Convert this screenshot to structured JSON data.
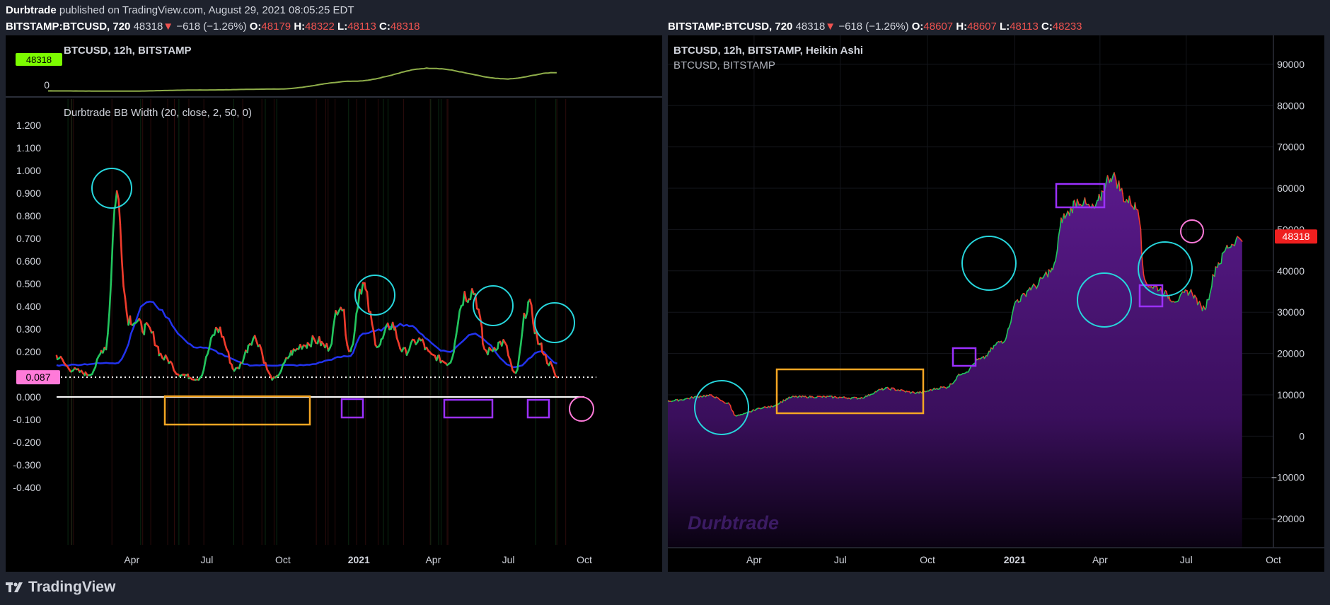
{
  "header": {
    "author": "Durbtrade",
    "published": "published on TradingView.com, August 29, 2021 08:05:25 EDT"
  },
  "left_quote": {
    "symbol": "BITSTAMP:BTCUSD, 720",
    "last": "48318",
    "change": "−618 (−1.26%)",
    "o_label": "O:",
    "o": "48179",
    "h_label": "H:",
    "h": "48322",
    "l_label": "L:",
    "l": "48113",
    "c_label": "C:",
    "c": "48318"
  },
  "right_quote": {
    "symbol": "BITSTAMP:BTCUSD, 720",
    "last": "48318",
    "change": "−618 (−1.26%)",
    "o_label": "O:",
    "o": "48607",
    "h_label": "H:",
    "h": "48607",
    "l_label": "L:",
    "l": "48113",
    "c_label": "C:",
    "c": "48233"
  },
  "colors": {
    "background": "#000000",
    "chrome": "#1e222d",
    "bull": "#22c55e",
    "bear": "#ef3b2c",
    "basis": "#2233ee",
    "cyan": "#27d6dc",
    "orange": "#f5a623",
    "purple": "#9b30ff",
    "pink": "#ff7ad9",
    "fill": "#4b1673"
  },
  "footer": {
    "brand": "TradingView",
    "icon": "tradingview-logo-icon"
  },
  "chart_data": [
    {
      "type": "line",
      "title": "BTCUSD, 12h, BITSTAMP",
      "price_badge": "48318",
      "y_tick_labels": [
        "0"
      ],
      "x_tick_labels": [],
      "series": [
        {
          "name": "BTCUSD",
          "x": [
            "2020-01",
            "2020-04",
            "2020-07",
            "2020-10",
            "2021-01",
            "2021-04",
            "2021-07",
            "2021-08-29"
          ],
          "values": [
            7200,
            6600,
            9200,
            11300,
            29000,
            58000,
            34000,
            48318
          ]
        }
      ]
    },
    {
      "type": "line",
      "title": "Durbtrade BB Width (20, close, 2, 50, 0)",
      "ylim": [
        -0.4,
        1.2
      ],
      "y_tick_labels": [
        "1.200",
        "1.100",
        "1.000",
        "0.900",
        "0.800",
        "0.700",
        "0.600",
        "0.500",
        "0.400",
        "0.300",
        "0.200",
        "0.100",
        "0.000",
        "-0.100",
        "-0.200",
        "-0.300",
        "-0.400"
      ],
      "x_tick_labels": [
        "Apr",
        "Jul",
        "Oct",
        "2021",
        "Apr",
        "Jul",
        "Oct"
      ],
      "threshold_badge": "0.087",
      "threshold": 0.087,
      "series": [
        {
          "x": [
            "2020-01-01",
            "2020-01-20",
            "2020-02-10",
            "2020-03-01",
            "2020-03-14",
            "2020-03-28",
            "2020-04-20",
            "2020-05-12",
            "2020-05-30",
            "2020-06-20",
            "2020-07-15",
            "2020-08-05",
            "2020-08-28",
            "2020-09-20",
            "2020-10-15",
            "2020-10-25",
            "2020-11-10",
            "2020-11-25",
            "2020-12-10",
            "2020-12-22",
            "2021-01-05",
            "2021-01-25",
            "2021-02-10",
            "2021-02-25",
            "2021-03-15",
            "2021-04-01",
            "2021-04-20",
            "2021-05-10",
            "2021-05-20",
            "2021-06-05",
            "2021-06-25",
            "2021-07-10",
            "2021-07-25",
            "2021-08-10",
            "2021-08-20",
            "2021-08-29"
          ],
          "values": [
            0.18,
            0.12,
            0.1,
            0.22,
            0.9,
            0.35,
            0.3,
            0.17,
            0.1,
            0.08,
            0.3,
            0.12,
            0.26,
            0.08,
            0.2,
            0.23,
            0.25,
            0.22,
            0.42,
            0.2,
            0.5,
            0.23,
            0.32,
            0.2,
            0.25,
            0.18,
            0.15,
            0.45,
            0.47,
            0.2,
            0.24,
            0.1,
            0.41,
            0.22,
            0.15,
            0.087
          ]
        },
        {
          "x": [
            "2020-01-01",
            "2020-03-14",
            "2020-04-20",
            "2020-06-20",
            "2020-08-28",
            "2020-10-25",
            "2020-12-22",
            "2021-01-05",
            "2021-02-25",
            "2021-04-20",
            "2021-05-20",
            "2021-07-10",
            "2021-08-10",
            "2021-08-29"
          ],
          "values": [
            0.14,
            0.15,
            0.42,
            0.22,
            0.14,
            0.14,
            0.18,
            0.28,
            0.32,
            0.2,
            0.28,
            0.13,
            0.2,
            0.15
          ]
        }
      ]
    },
    {
      "type": "area",
      "title": "BTCUSD, 12h, BITSTAMP, Heikin Ashi",
      "subtitle": "BTCUSD, BITSTAMP",
      "watermark": "Durbtrade",
      "price_badge": "48318",
      "ylim": [
        -27000,
        97000
      ],
      "y_tick_labels": [
        "90000",
        "80000",
        "70000",
        "60000",
        "50000",
        "40000",
        "30000",
        "20000",
        "10000",
        "0",
        "−10000",
        "−20000"
      ],
      "x_tick_labels": [
        "Apr",
        "Jul",
        "Oct",
        "2021",
        "Apr",
        "Jul",
        "Oct"
      ],
      "series": [
        {
          "x": [
            "2020-01-01",
            "2020-02-15",
            "2020-03-05",
            "2020-03-13",
            "2020-04-15",
            "2020-05-15",
            "2020-06-15",
            "2020-07-20",
            "2020-08-20",
            "2020-09-20",
            "2020-10-20",
            "2020-11-10",
            "2020-11-25",
            "2020-12-20",
            "2021-01-05",
            "2021-01-20",
            "2021-02-10",
            "2021-02-22",
            "2021-03-10",
            "2021-03-25",
            "2021-04-14",
            "2021-05-01",
            "2021-05-12",
            "2021-05-19",
            "2021-05-30",
            "2021-06-20",
            "2021-07-05",
            "2021-07-20",
            "2021-08-05",
            "2021-08-15",
            "2021-08-29"
          ],
          "values": [
            8500,
            9800,
            8000,
            5000,
            7000,
            9500,
            9500,
            9200,
            11500,
            10500,
            11800,
            15500,
            18500,
            23000,
            33000,
            36000,
            40000,
            53000,
            57000,
            55000,
            63000,
            57000,
            55000,
            37000,
            36000,
            33000,
            35000,
            31000,
            42000,
            46000,
            48318
          ]
        }
      ]
    }
  ]
}
